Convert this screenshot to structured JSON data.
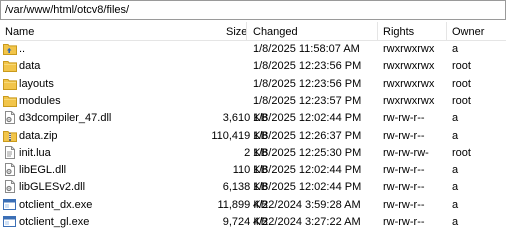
{
  "path": "/var/www/html/otcv8/files/",
  "columns": {
    "name": "Name",
    "size": "Size",
    "changed": "Changed",
    "rights": "Rights",
    "owner": "Owner"
  },
  "rows": [
    {
      "name": "..",
      "size": "",
      "changed": "1/8/2025 11:58:07 AM",
      "rights": "rwxrwxrwx",
      "owner": "a",
      "icon": "parent-folder-icon"
    },
    {
      "name": "data",
      "size": "",
      "changed": "1/8/2025 12:23:56 PM",
      "rights": "rwxrwxrwx",
      "owner": "root",
      "icon": "folder-icon"
    },
    {
      "name": "layouts",
      "size": "",
      "changed": "1/8/2025 12:23:56 PM",
      "rights": "rwxrwxrwx",
      "owner": "root",
      "icon": "folder-icon"
    },
    {
      "name": "modules",
      "size": "",
      "changed": "1/8/2025 12:23:57 PM",
      "rights": "rwxrwxrwx",
      "owner": "root",
      "icon": "folder-icon"
    },
    {
      "name": "d3dcompiler_47.dll",
      "size": "3,610 KB",
      "changed": "1/8/2025 12:02:44 PM",
      "rights": "rw-rw-r--",
      "owner": "a",
      "icon": "dll-file-icon"
    },
    {
      "name": "data.zip",
      "size": "110,419 KB",
      "changed": "1/8/2025 12:26:37 PM",
      "rights": "rw-rw-r--",
      "owner": "a",
      "icon": "zip-folder-icon"
    },
    {
      "name": "init.lua",
      "size": "2 KB",
      "changed": "1/8/2025 12:25:30 PM",
      "rights": "rw-rw-rw-",
      "owner": "root",
      "icon": "text-file-icon"
    },
    {
      "name": "libEGL.dll",
      "size": "110 KB",
      "changed": "1/8/2025 12:02:44 PM",
      "rights": "rw-rw-r--",
      "owner": "a",
      "icon": "dll-file-icon"
    },
    {
      "name": "libGLESv2.dll",
      "size": "6,138 KB",
      "changed": "1/8/2025 12:02:44 PM",
      "rights": "rw-rw-r--",
      "owner": "a",
      "icon": "dll-file-icon"
    },
    {
      "name": "otclient_dx.exe",
      "size": "11,899 KB",
      "changed": "4/22/2024 3:59:28 AM",
      "rights": "rw-rw-r--",
      "owner": "a",
      "icon": "exe-file-icon"
    },
    {
      "name": "otclient_gl.exe",
      "size": "9,724 KB",
      "changed": "4/22/2024 3:27:22 AM",
      "rights": "rw-rw-r--",
      "owner": "a",
      "icon": "exe-file-icon"
    }
  ]
}
